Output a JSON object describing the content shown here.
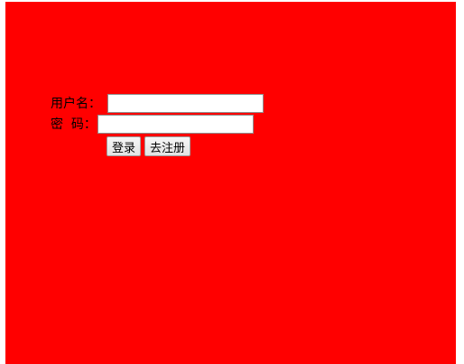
{
  "colors": {
    "panel_background": "#ff0000",
    "page_background": "#ffffff"
  },
  "login_form": {
    "username_label": "用户名：",
    "username_value": "",
    "password_label": "密  码：",
    "password_value": "",
    "login_button": "登录",
    "register_button": "去注册"
  }
}
